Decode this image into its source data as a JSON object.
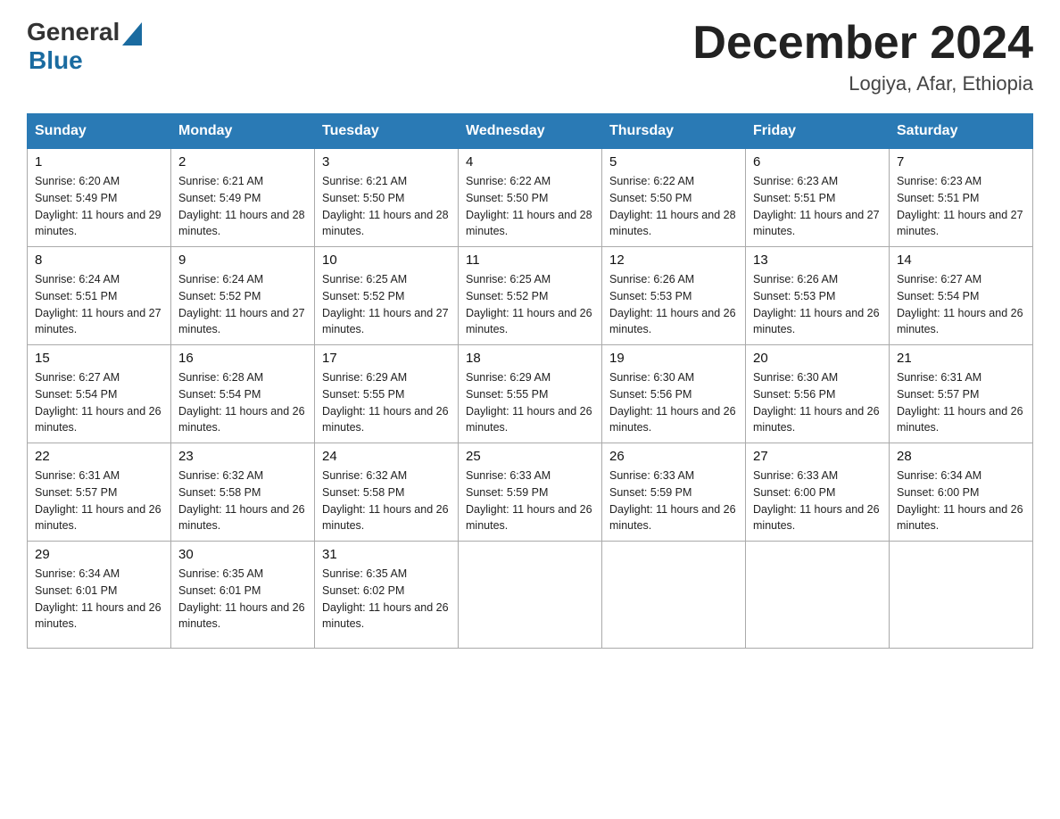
{
  "header": {
    "logo_general": "General",
    "logo_blue": "Blue",
    "month_title": "December 2024",
    "location": "Logiya, Afar, Ethiopia"
  },
  "weekdays": [
    "Sunday",
    "Monday",
    "Tuesday",
    "Wednesday",
    "Thursday",
    "Friday",
    "Saturday"
  ],
  "weeks": [
    [
      {
        "day": "1",
        "sunrise": "6:20 AM",
        "sunset": "5:49 PM",
        "daylight": "11 hours and 29 minutes."
      },
      {
        "day": "2",
        "sunrise": "6:21 AM",
        "sunset": "5:49 PM",
        "daylight": "11 hours and 28 minutes."
      },
      {
        "day": "3",
        "sunrise": "6:21 AM",
        "sunset": "5:50 PM",
        "daylight": "11 hours and 28 minutes."
      },
      {
        "day": "4",
        "sunrise": "6:22 AM",
        "sunset": "5:50 PM",
        "daylight": "11 hours and 28 minutes."
      },
      {
        "day": "5",
        "sunrise": "6:22 AM",
        "sunset": "5:50 PM",
        "daylight": "11 hours and 28 minutes."
      },
      {
        "day": "6",
        "sunrise": "6:23 AM",
        "sunset": "5:51 PM",
        "daylight": "11 hours and 27 minutes."
      },
      {
        "day": "7",
        "sunrise": "6:23 AM",
        "sunset": "5:51 PM",
        "daylight": "11 hours and 27 minutes."
      }
    ],
    [
      {
        "day": "8",
        "sunrise": "6:24 AM",
        "sunset": "5:51 PM",
        "daylight": "11 hours and 27 minutes."
      },
      {
        "day": "9",
        "sunrise": "6:24 AM",
        "sunset": "5:52 PM",
        "daylight": "11 hours and 27 minutes."
      },
      {
        "day": "10",
        "sunrise": "6:25 AM",
        "sunset": "5:52 PM",
        "daylight": "11 hours and 27 minutes."
      },
      {
        "day": "11",
        "sunrise": "6:25 AM",
        "sunset": "5:52 PM",
        "daylight": "11 hours and 26 minutes."
      },
      {
        "day": "12",
        "sunrise": "6:26 AM",
        "sunset": "5:53 PM",
        "daylight": "11 hours and 26 minutes."
      },
      {
        "day": "13",
        "sunrise": "6:26 AM",
        "sunset": "5:53 PM",
        "daylight": "11 hours and 26 minutes."
      },
      {
        "day": "14",
        "sunrise": "6:27 AM",
        "sunset": "5:54 PM",
        "daylight": "11 hours and 26 minutes."
      }
    ],
    [
      {
        "day": "15",
        "sunrise": "6:27 AM",
        "sunset": "5:54 PM",
        "daylight": "11 hours and 26 minutes."
      },
      {
        "day": "16",
        "sunrise": "6:28 AM",
        "sunset": "5:54 PM",
        "daylight": "11 hours and 26 minutes."
      },
      {
        "day": "17",
        "sunrise": "6:29 AM",
        "sunset": "5:55 PM",
        "daylight": "11 hours and 26 minutes."
      },
      {
        "day": "18",
        "sunrise": "6:29 AM",
        "sunset": "5:55 PM",
        "daylight": "11 hours and 26 minutes."
      },
      {
        "day": "19",
        "sunrise": "6:30 AM",
        "sunset": "5:56 PM",
        "daylight": "11 hours and 26 minutes."
      },
      {
        "day": "20",
        "sunrise": "6:30 AM",
        "sunset": "5:56 PM",
        "daylight": "11 hours and 26 minutes."
      },
      {
        "day": "21",
        "sunrise": "6:31 AM",
        "sunset": "5:57 PM",
        "daylight": "11 hours and 26 minutes."
      }
    ],
    [
      {
        "day": "22",
        "sunrise": "6:31 AM",
        "sunset": "5:57 PM",
        "daylight": "11 hours and 26 minutes."
      },
      {
        "day": "23",
        "sunrise": "6:32 AM",
        "sunset": "5:58 PM",
        "daylight": "11 hours and 26 minutes."
      },
      {
        "day": "24",
        "sunrise": "6:32 AM",
        "sunset": "5:58 PM",
        "daylight": "11 hours and 26 minutes."
      },
      {
        "day": "25",
        "sunrise": "6:33 AM",
        "sunset": "5:59 PM",
        "daylight": "11 hours and 26 minutes."
      },
      {
        "day": "26",
        "sunrise": "6:33 AM",
        "sunset": "5:59 PM",
        "daylight": "11 hours and 26 minutes."
      },
      {
        "day": "27",
        "sunrise": "6:33 AM",
        "sunset": "6:00 PM",
        "daylight": "11 hours and 26 minutes."
      },
      {
        "day": "28",
        "sunrise": "6:34 AM",
        "sunset": "6:00 PM",
        "daylight": "11 hours and 26 minutes."
      }
    ],
    [
      {
        "day": "29",
        "sunrise": "6:34 AM",
        "sunset": "6:01 PM",
        "daylight": "11 hours and 26 minutes."
      },
      {
        "day": "30",
        "sunrise": "6:35 AM",
        "sunset": "6:01 PM",
        "daylight": "11 hours and 26 minutes."
      },
      {
        "day": "31",
        "sunrise": "6:35 AM",
        "sunset": "6:02 PM",
        "daylight": "11 hours and 26 minutes."
      },
      null,
      null,
      null,
      null
    ]
  ]
}
